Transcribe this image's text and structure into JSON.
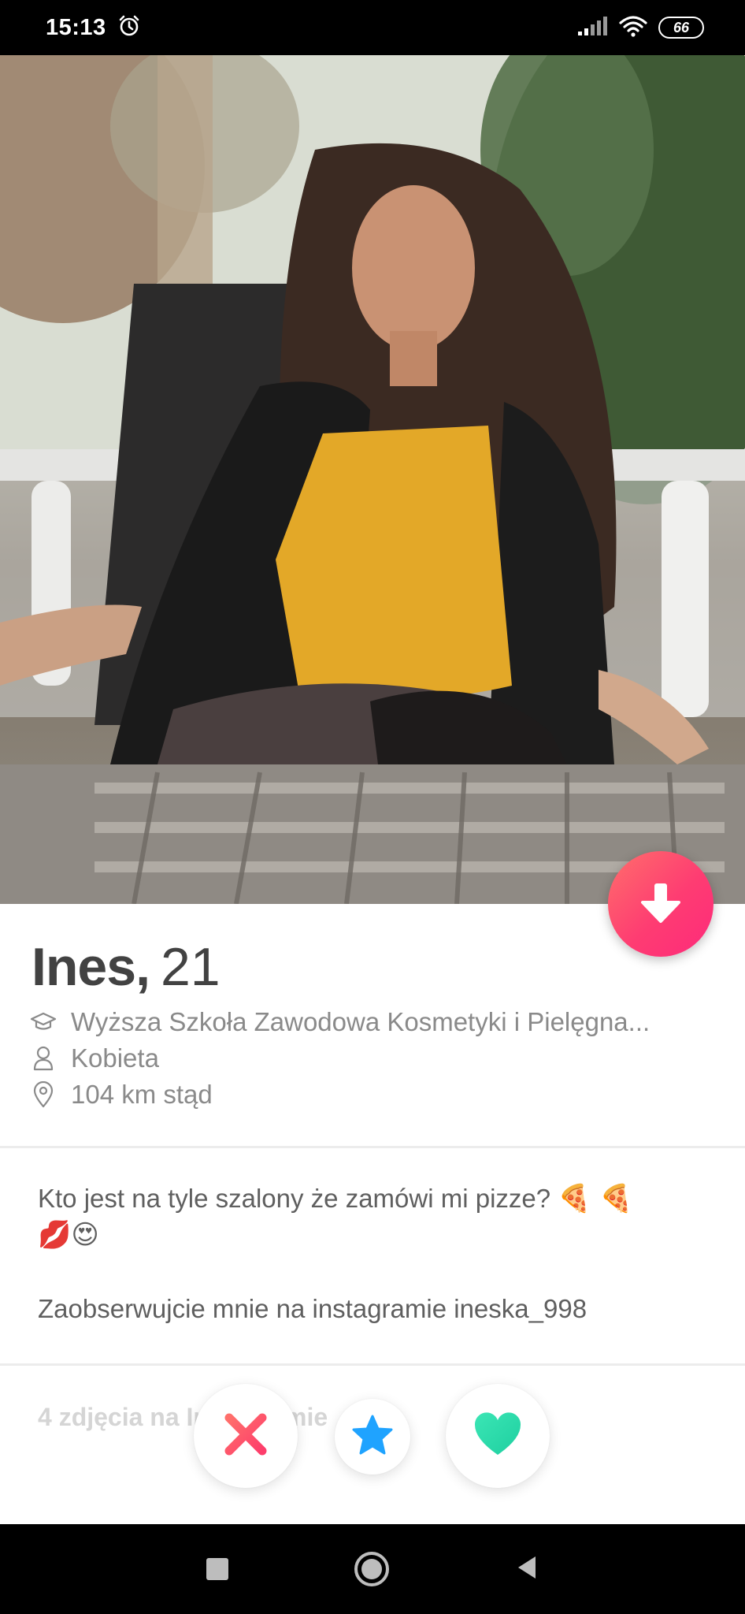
{
  "status_bar": {
    "time": "15:13",
    "battery": "66",
    "icons": [
      "alarm-icon",
      "signal-icon",
      "wifi-icon",
      "battery-icon"
    ]
  },
  "profile": {
    "name": "Ines,",
    "age": "21",
    "school": "Wyższa Szkoła Zawodowa Kosmetyki i Pielęgna...",
    "gender": "Kobieta",
    "distance": "104 km stąd"
  },
  "bio": {
    "line1_text": "Kto jest na tyle szalony że zamówi mi pizze?",
    "line1_emoji": "🍕 🍕",
    "line2_emoji": "💋😍",
    "line3": "Zaobserwujcie mnie na instagramie ineska_998"
  },
  "photos_section": {
    "label": "4 zdjęcia na Instagramie"
  },
  "colors": {
    "brand_gradient_start": "#ff6f6b",
    "brand_gradient_end": "#fd2a7b",
    "nope": "#fd5068",
    "super_like": "#1fa3ff",
    "like": "#3be6b5"
  }
}
